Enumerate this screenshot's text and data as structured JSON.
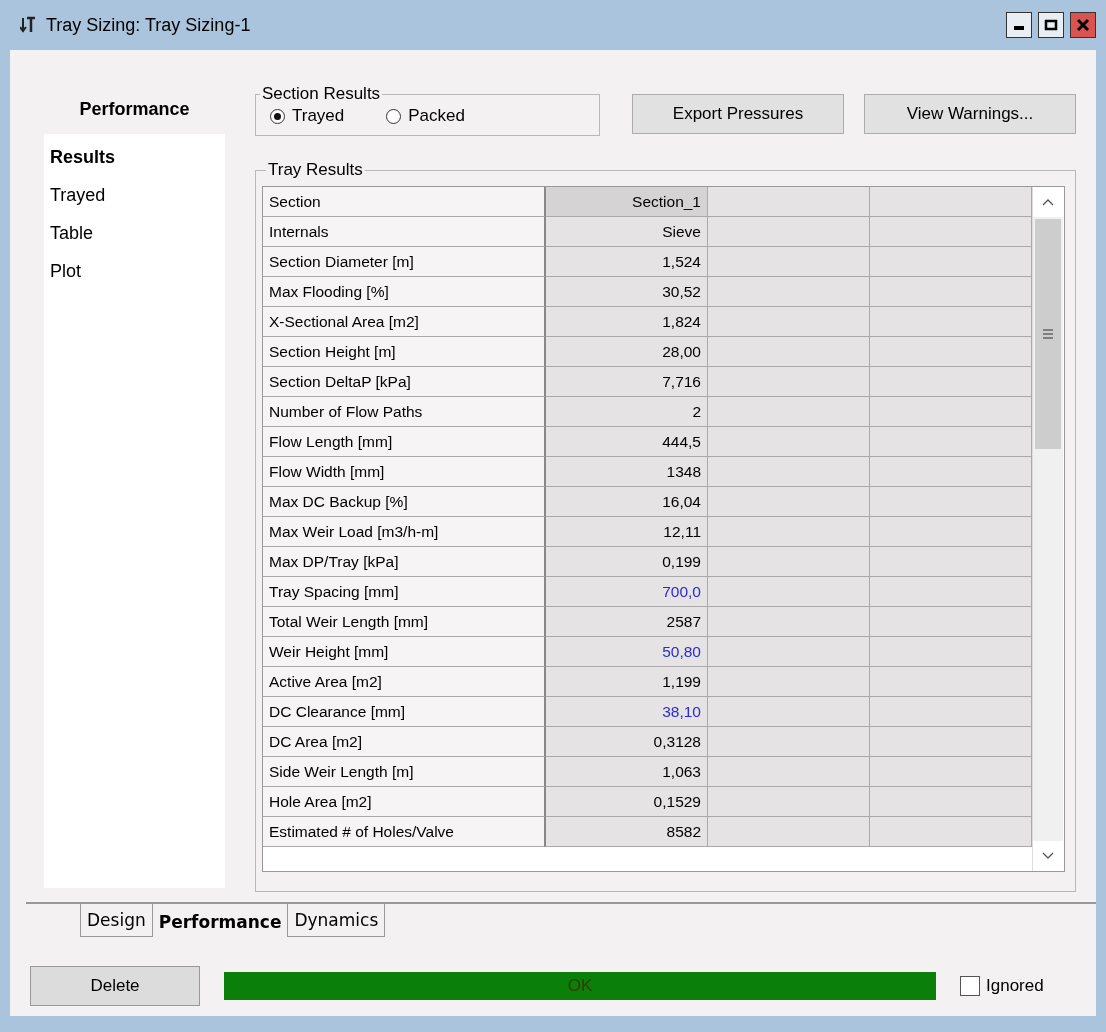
{
  "window": {
    "title": "Tray Sizing: Tray Sizing-1"
  },
  "sidebar": {
    "title": "Performance",
    "items": [
      {
        "label": "Results",
        "selected": true
      },
      {
        "label": "Trayed",
        "selected": false
      },
      {
        "label": "Table",
        "selected": false
      },
      {
        "label": "Plot",
        "selected": false
      }
    ]
  },
  "section_results": {
    "title": "Section Results",
    "options": [
      {
        "label": "Trayed",
        "selected": true
      },
      {
        "label": "Packed",
        "selected": false
      }
    ]
  },
  "buttons": [
    "Export Pressures",
    "View Warnings..."
  ],
  "tray_results": {
    "title": "Tray Results",
    "columns": [
      "Section",
      "Section_1"
    ],
    "rows": [
      {
        "label": "Internals",
        "value": "Sieve",
        "specified": false
      },
      {
        "label": "Section Diameter [m]",
        "value": "1,524",
        "specified": false
      },
      {
        "label": "Max Flooding [%]",
        "value": "30,52",
        "specified": false
      },
      {
        "label": "X-Sectional Area [m2]",
        "value": "1,824",
        "specified": false
      },
      {
        "label": "Section Height [m]",
        "value": "28,00",
        "specified": false
      },
      {
        "label": "Section DeltaP [kPa]",
        "value": "7,716",
        "specified": false
      },
      {
        "label": "Number of Flow Paths",
        "value": "2",
        "specified": false
      },
      {
        "label": "Flow Length [mm]",
        "value": "444,5",
        "specified": false
      },
      {
        "label": "Flow Width [mm]",
        "value": "1348",
        "specified": false
      },
      {
        "label": "Max DC Backup [%]",
        "value": "16,04",
        "specified": false
      },
      {
        "label": "Max Weir Load [m3/h-m]",
        "value": "12,11",
        "specified": false
      },
      {
        "label": "Max DP/Tray [kPa]",
        "value": "0,199",
        "specified": false
      },
      {
        "label": "Tray Spacing [mm]",
        "value": "700,0",
        "specified": true
      },
      {
        "label": "Total Weir Length [mm]",
        "value": "2587",
        "specified": false
      },
      {
        "label": "Weir Height [mm]",
        "value": "50,80",
        "specified": true
      },
      {
        "label": "Active Area [m2]",
        "value": "1,199",
        "specified": false
      },
      {
        "label": "DC Clearance [mm]",
        "value": "38,10",
        "specified": true
      },
      {
        "label": "DC Area [m2]",
        "value": "0,3128",
        "specified": false
      },
      {
        "label": "Side Weir Length [m]",
        "value": "1,063",
        "specified": false
      },
      {
        "label": "Hole Area [m2]",
        "value": "0,1529",
        "specified": false
      },
      {
        "label": "Estimated # of Holes/Valve",
        "value": "8582",
        "specified": false
      }
    ]
  },
  "tabs": [
    {
      "label": "Design",
      "selected": false
    },
    {
      "label": "Performance",
      "selected": true
    },
    {
      "label": "Dynamics",
      "selected": false
    }
  ],
  "status_bar": {
    "delete_button": "Delete",
    "status": "OK",
    "ignored": {
      "label": "Ignored",
      "checked": false
    }
  }
}
